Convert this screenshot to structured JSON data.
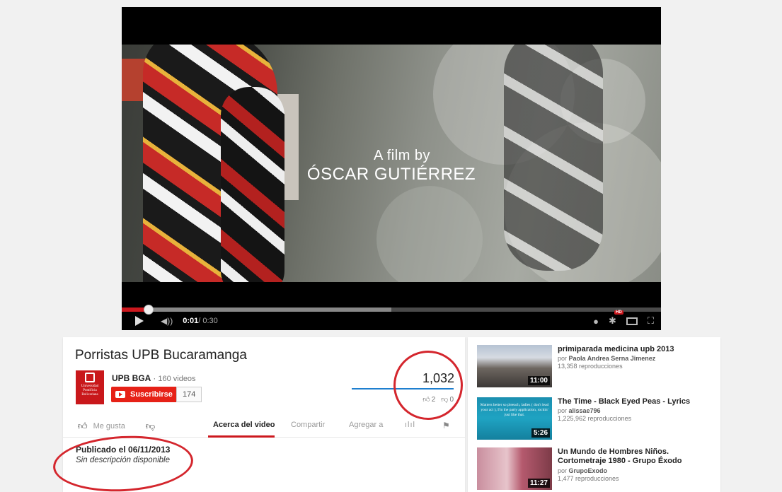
{
  "player": {
    "credit_line1": "A film by",
    "credit_line2": "ÓSCAR GUTIÉRREZ",
    "time_current": "0:01",
    "time_total": " / 0:30",
    "played_fraction": 0.05,
    "loaded_fraction": 0.5,
    "hd_badge": "HD",
    "volume_icon": "volume-icon"
  },
  "video": {
    "title": "Porristas UPB Bucaramanga",
    "channel": {
      "name": "UPB BGA",
      "separator": "·",
      "videos": "160 videos",
      "avatar_text": "Universidad Pontificia Bolivariana",
      "subscribe_label": "Suscribirse",
      "subscriber_count": "174"
    },
    "views": "1,032",
    "likes": "2",
    "dislikes": "0",
    "sentiment_fraction": 1.0
  },
  "actions": {
    "like_label": "Me gusta",
    "tab_about": "Acerca del video",
    "tab_share": "Compartir",
    "tab_add": "Agregar a"
  },
  "details": {
    "published": "Publicado el 06/11/2013",
    "description": "Sin descripción disponible"
  },
  "recommendations": [
    {
      "title": "primiparada medicina upb 2013",
      "author_prefix": "por ",
      "author": "Paola Andrea Serna Jimenez",
      "views": "13,358 reproducciones",
      "duration": "11:00"
    },
    {
      "title": "The Time - Black Eyed Peas - Lyrics",
      "author_prefix": "por ",
      "author": "alissae796",
      "views": "1,225,962 reproducciones",
      "duration": "5:26",
      "thumb_text": "Matters better so pleeach, ladies ( don't lead your act ), I'm the party application, rockin' just like that."
    },
    {
      "title": "Un Mundo de Hombres Niños. Cortometraje 1980 - Grupo Éxodo",
      "author_prefix": "por ",
      "author": "GrupoExodo",
      "views": "1,477 reproducciones",
      "duration": "11:27"
    }
  ],
  "annotation_color": "#d4262d",
  "accent_red": "#cc181e",
  "sentiment_blue": "#1e7fcf"
}
